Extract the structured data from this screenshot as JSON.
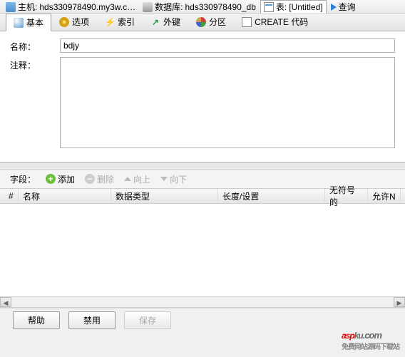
{
  "breadcrumb": {
    "host_label": "主机:",
    "host_value": "hds330978490.my3w.c…",
    "db_label": "数据库:",
    "db_value": "hds330978490_db",
    "table_label": "表:",
    "table_value": "[Untitled]",
    "query": "查询"
  },
  "tabs": {
    "basic": "基本",
    "option": "选项",
    "index": "索引",
    "fk": "外键",
    "partition": "分区",
    "create": "CREATE 代码"
  },
  "form": {
    "name_label": "名称：",
    "name_value": "bdjy",
    "comment_label": "注释：",
    "comment_value": ""
  },
  "fields": {
    "label": "字段：",
    "add": "添加",
    "delete": "删除",
    "up": "向上",
    "down": "向下"
  },
  "grid": {
    "num": "#",
    "name": "名称",
    "type": "数据类型",
    "len": "长度/设置",
    "unsigned": "无符号的",
    "null": "允许N"
  },
  "buttons": {
    "help": "帮助",
    "disable": "禁用",
    "save": "保存"
  },
  "watermark": {
    "brand": "aspku",
    "dotcom": ".com",
    "tagline": "免费网站源码下载站"
  }
}
